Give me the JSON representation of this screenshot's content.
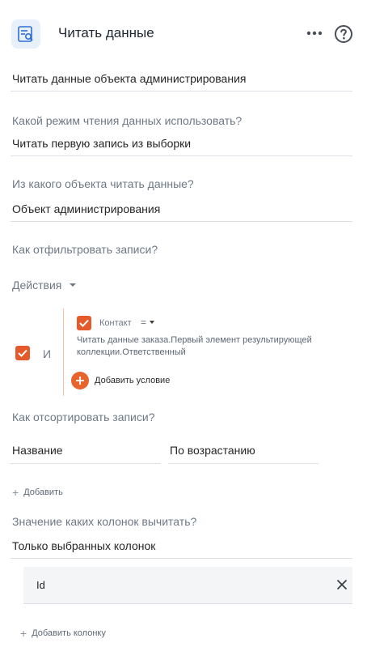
{
  "header": {
    "icon": "read-data-icon",
    "title": "Читать данные",
    "more_icon": "more-dots-icon",
    "help_icon": "help-circle-icon"
  },
  "element_name": "Читать данные объекта администрирования",
  "read_mode": {
    "question": "Какой режим чтения данных использовать?",
    "value": "Читать первую запись из выборки"
  },
  "source_object": {
    "question": "Из какого объекта читать данные?",
    "value": "Объект администрирования"
  },
  "filter": {
    "question": "Как отфильтровать записи?",
    "actions_label": "Действия",
    "group_operator": "И",
    "condition": {
      "column": "Контакт",
      "operator": "=",
      "value": "Читать данные заказа.Первый элемент результирующей коллекции.Ответственный"
    },
    "add_condition_label": "Добавить условие"
  },
  "sort": {
    "question": "Как отсортировать записи?",
    "column": "Название",
    "direction": "По возрастанию",
    "add_label": "Добавить"
  },
  "columns": {
    "question": "Значение каких колонок вычитать?",
    "mode": "Только выбранных колонок",
    "items": [
      "Id"
    ],
    "add_label": "Добавить колонку"
  },
  "colors": {
    "accent": "#e55a2b",
    "icon_bg": "#e8f0fc",
    "icon_fg": "#2f6fd6"
  }
}
